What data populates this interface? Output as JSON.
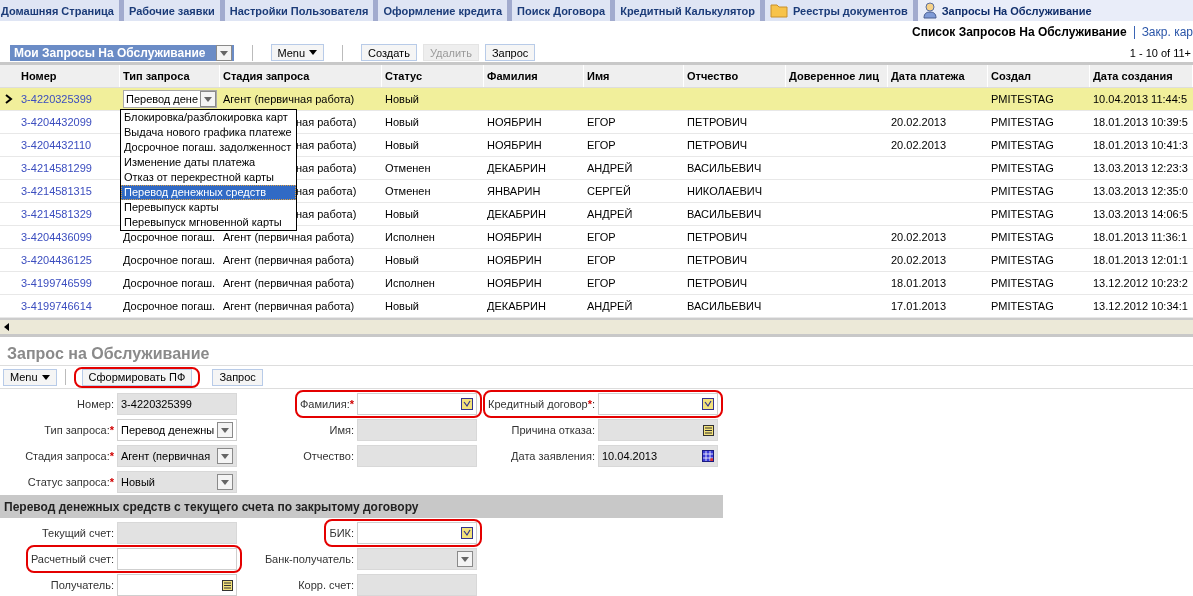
{
  "tabs": [
    {
      "label": "Домашняя Страница",
      "selected": false,
      "kind": "plain"
    },
    {
      "label": "Рабочие заявки",
      "selected": false,
      "kind": "plain"
    },
    {
      "label": "Настройки Пользователя",
      "selected": false,
      "kind": "plain"
    },
    {
      "label": "Оформление кредита",
      "selected": false,
      "kind": "plain"
    },
    {
      "label": "Поиск Договора",
      "selected": false,
      "kind": "plain"
    },
    {
      "label": "Кредитный Калькулятор",
      "selected": false,
      "kind": "plain"
    },
    {
      "label": "Реестры документов",
      "selected": false,
      "kind": "folder"
    },
    {
      "label": "Запросы На Обслуживание",
      "selected": true,
      "kind": "person"
    }
  ],
  "breadcrumb": {
    "current": "Список Запросов На Обслуживание",
    "link": "Закр. кар"
  },
  "list_toolbar": {
    "view": "Мои Запросы На Обслуживание",
    "menu": "Menu",
    "buttons": [
      {
        "label": "Создать",
        "disabled": false
      },
      {
        "label": "Удалить",
        "disabled": true
      },
      {
        "label": "Запрос",
        "disabled": false
      }
    ],
    "pager": "1 - 10 of 11+"
  },
  "table": {
    "columns": [
      "Номер",
      "Тип запроса",
      "Стадия запроса",
      "Статус",
      "Фамилия",
      "Имя",
      "Отчество",
      "Доверенное лиц",
      "Дата платежа",
      "Создал",
      "Дата создания"
    ],
    "rows": [
      {
        "selected": true,
        "editing": true,
        "number": "3-4220325399",
        "type": "Перевод дене",
        "stage": "Агент (первичная работа)",
        "status": "Новый",
        "created_by": "PMITESTAG",
        "created_at": "10.04.2013 11:44:5"
      },
      {
        "selected": false,
        "editing": false,
        "partly_covered": true,
        "number": "3-4204432099",
        "stage": "ная работа)",
        "status": "Новый",
        "surname": "НОЯБРИН",
        "name": "ЕГОР",
        "patronymic": "ПЕТРОВИЧ",
        "payment_date": "20.02.2013",
        "created_by": "PMITESTAG",
        "created_at": "18.01.2013 10:39:5"
      },
      {
        "selected": false,
        "editing": false,
        "partly_covered": true,
        "number": "3-4204432110",
        "stage": "ная работа)",
        "status": "Новый",
        "surname": "НОЯБРИН",
        "name": "ЕГОР",
        "patronymic": "ПЕТРОВИЧ",
        "payment_date": "20.02.2013",
        "created_by": "PMITESTAG",
        "created_at": "18.01.2013 10:41:3"
      },
      {
        "selected": false,
        "editing": false,
        "partly_covered": true,
        "number": "3-4214581299",
        "stage": "ная работа)",
        "status": "Отменен",
        "surname": "ДЕКАБРИН",
        "name": "АНДРЕЙ",
        "patronymic": "ВАСИЛЬЕВИЧ",
        "created_by": "PMITESTAG",
        "created_at": "13.03.2013 12:23:3"
      },
      {
        "selected": false,
        "editing": false,
        "partly_covered": true,
        "number": "3-4214581315",
        "stage": "ная работа)",
        "status": "Отменен",
        "surname": "ЯНВАРИН",
        "name": "СЕРГЕЙ",
        "patronymic": "НИКОЛАЕВИЧ",
        "created_by": "PMITESTAG",
        "created_at": "13.03.2013 12:35:0"
      },
      {
        "selected": false,
        "editing": false,
        "partly_covered": true,
        "number": "3-4214581329",
        "stage": "ная работа)",
        "status": "Новый",
        "surname": "ДЕКАБРИН",
        "name": "АНДРЕЙ",
        "patronymic": "ВАСИЛЬЕВИЧ",
        "created_by": "PMITESTAG",
        "created_at": "13.03.2013 14:06:5"
      },
      {
        "selected": false,
        "editing": false,
        "number": "3-4204436099",
        "type": "Досрочное погаш.",
        "stage": "Агент (первичная работа)",
        "status": "Исполнен",
        "surname": "НОЯБРИН",
        "name": "ЕГОР",
        "patronymic": "ПЕТРОВИЧ",
        "payment_date": "20.02.2013",
        "created_by": "PMITESTAG",
        "created_at": "18.01.2013 11:36:1"
      },
      {
        "selected": false,
        "editing": false,
        "number": "3-4204436125",
        "type": "Досрочное погаш.",
        "stage": "Агент (первичная работа)",
        "status": "Новый",
        "surname": "НОЯБРИН",
        "name": "ЕГОР",
        "patronymic": "ПЕТРОВИЧ",
        "payment_date": "20.02.2013",
        "created_by": "PMITESTAG",
        "created_at": "18.01.2013 12:01:1"
      },
      {
        "selected": false,
        "editing": false,
        "number": "3-4199746599",
        "type": "Досрочное погаш.",
        "stage": "Агент (первичная работа)",
        "status": "Исполнен",
        "surname": "НОЯБРИН",
        "name": "ЕГОР",
        "patronymic": "ПЕТРОВИЧ",
        "payment_date": "18.01.2013",
        "created_by": "PMITESTAG",
        "created_at": "13.12.2012 10:23:2"
      },
      {
        "selected": false,
        "editing": false,
        "number": "3-4199746614",
        "type": "Досрочное погаш.",
        "stage": "Агент (первичная работа)",
        "status": "Новый",
        "surname": "ДЕКАБРИН",
        "name": "АНДРЕЙ",
        "patronymic": "ВАСИЛЬЕВИЧ",
        "payment_date": "17.01.2013",
        "created_by": "PMITESTAG",
        "created_at": "13.12.2012 10:34:1"
      }
    ],
    "dropdown": [
      {
        "label": "Блокировка/разблокировка карт",
        "selected": false
      },
      {
        "label": "Выдача нового графика платеже",
        "selected": false
      },
      {
        "label": "Досрочное погаш. задолженност",
        "selected": false
      },
      {
        "label": "Изменение даты платежа",
        "selected": false
      },
      {
        "label": "Отказ от перекрестной карты",
        "selected": false
      },
      {
        "label": "Перевод денежных средств",
        "selected": true
      },
      {
        "label": "Перевыпуск карты",
        "selected": false
      },
      {
        "label": "Перевыпуск мгновенной карты",
        "selected": false
      }
    ]
  },
  "form": {
    "title": "Запрос на Обслуживание",
    "menu": "Menu",
    "buttons": [
      {
        "label": "Сформировать ПФ",
        "highlighted": true
      },
      {
        "label": "Запрос",
        "highlighted": false
      }
    ],
    "sections": [
      {
        "columns": [
          [
            {
              "label": "Номер:",
              "kind": "text",
              "readonly": true,
              "highlighted": false,
              "value": "3-4220325399"
            },
            {
              "label": "Тип запроса:",
              "required_mark": "*",
              "kind": "select",
              "readonly": false,
              "highlighted": false,
              "value": "Перевод денежны"
            },
            {
              "label": "Стадия запроса:",
              "required_mark": "*",
              "kind": "select",
              "readonly": true,
              "highlighted": false,
              "value": "Агент (первичная"
            },
            {
              "label": "Статус запроса:",
              "required_mark": "*",
              "kind": "select",
              "readonly": true,
              "highlighted": false,
              "value": "Новый"
            }
          ],
          [
            {
              "label": "Фамилия:",
              "required_mark": "*",
              "kind": "lookup",
              "readonly": false,
              "highlighted": true
            },
            {
              "label": "Имя:",
              "kind": "text",
              "readonly": true,
              "highlighted": false
            },
            {
              "label": "Отчество:",
              "kind": "text",
              "readonly": true,
              "highlighted": false
            }
          ],
          [
            {
              "label": "Кредитный договор",
              "required_mark": "*",
              "label_suffix": ":",
              "kind": "lookup",
              "readonly": false,
              "highlighted": true
            },
            {
              "label": "Причина отказа:",
              "kind": "list",
              "readonly": true,
              "highlighted": false
            },
            {
              "label": "Дата заявления:",
              "kind": "date",
              "readonly": true,
              "highlighted": false,
              "value": "10.04.2013"
            }
          ]
        ]
      },
      {
        "title": "Перевод денежных средств с текущего счета по закрытому договору",
        "columns": [
          [
            {
              "label": "Текущий счет:",
              "kind": "text",
              "readonly": true,
              "highlighted": false
            },
            {
              "label": "Расчетный счет:",
              "kind": "text",
              "readonly": false,
              "highlighted": true
            },
            {
              "label": "Получатель:",
              "kind": "list",
              "readonly": false,
              "highlighted": false
            }
          ],
          [
            {
              "label": "БИК:",
              "kind": "lookup",
              "readonly": false,
              "highlighted": true
            },
            {
              "label": "Банк-получатель:",
              "kind": "select",
              "readonly": true,
              "highlighted": false
            },
            {
              "label": "Корр. счет:",
              "kind": "text",
              "readonly": true,
              "highlighted": false
            }
          ]
        ]
      }
    ]
  }
}
